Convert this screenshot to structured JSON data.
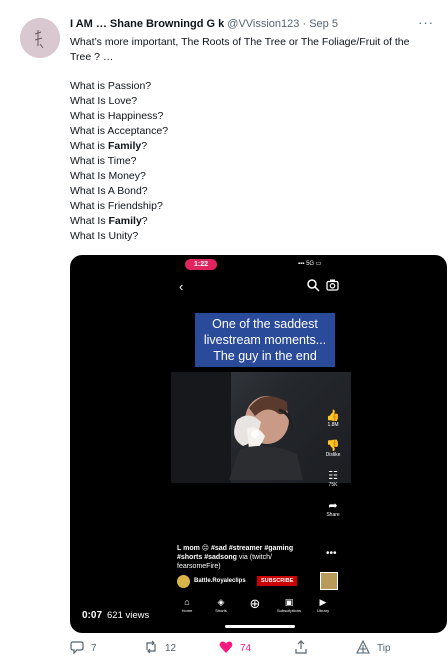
{
  "tweet": {
    "author_name": "I AM … Shane Browningd G k",
    "handle": "@VVission123",
    "dot": "·",
    "date": "Sep 5",
    "more_label": "···",
    "intro_line1": "What’s more important, The Roots of The Tree or The Foliage/Fruit of the",
    "intro_line2": "Tree ? …",
    "questions": [
      {
        "pre": "What is Passion?",
        "bold": "",
        "post": ""
      },
      {
        "pre": "What Is Love?",
        "bold": "",
        "post": ""
      },
      {
        "pre": "What is Happiness?",
        "bold": "",
        "post": ""
      },
      {
        "pre": "What is Acceptance?",
        "bold": "",
        "post": ""
      },
      {
        "pre": "What is ",
        "bold": "Family",
        "post": "?"
      },
      {
        "pre": "What is Time?",
        "bold": "",
        "post": ""
      },
      {
        "pre": "What Is Money?",
        "bold": "",
        "post": ""
      },
      {
        "pre": "What Is A Bond?",
        "bold": "",
        "post": ""
      },
      {
        "pre": "What is Friendship?",
        "bold": "",
        "post": ""
      },
      {
        "pre": "What Is ",
        "bold": "Family",
        "post": "?"
      },
      {
        "pre": "What Is Unity?",
        "bold": "",
        "post": ""
      }
    ]
  },
  "media": {
    "status_time": "1:22",
    "signal": "5G",
    "back_glyph": "‹",
    "caption_lines": [
      "One of the saddest",
      "livestream moments...",
      "The guy in the end"
    ],
    "side_actions": [
      {
        "glyph": "👍",
        "label": "1.8M"
      },
      {
        "glyph": "👎",
        "label": "Dislike"
      },
      {
        "glyph": "☷",
        "label": "75K"
      },
      {
        "glyph": "➦",
        "label": "Share"
      }
    ],
    "description_line1": "L mom 😔 #sad #streamer #gaming",
    "description_line2": "#shorts #sadsong",
    "description_via": " via (twitch/",
    "description_line3": "fearsomeFire)",
    "more_glyph": "•••",
    "channel_name": "Battle.Royaleclips",
    "subscribe_label": "SUBSCRIBE",
    "nav": [
      {
        "glyph": "⌂",
        "label": "Home"
      },
      {
        "glyph": "◈",
        "label": "Shorts"
      },
      {
        "glyph": "⊕",
        "label": ""
      },
      {
        "glyph": "▣",
        "label": "Subscriptions"
      },
      {
        "glyph": "▶",
        "label": "Library"
      }
    ],
    "duration": "0:07",
    "views": "621 views"
  },
  "actions": {
    "replies": "7",
    "retweets": "12",
    "likes": "74",
    "tip_label": "Tip"
  },
  "colors": {
    "like": "#f91880",
    "text_secondary": "#536471",
    "caption_bg": "#2a4a9a",
    "subscribe_red": "#cc0000"
  }
}
